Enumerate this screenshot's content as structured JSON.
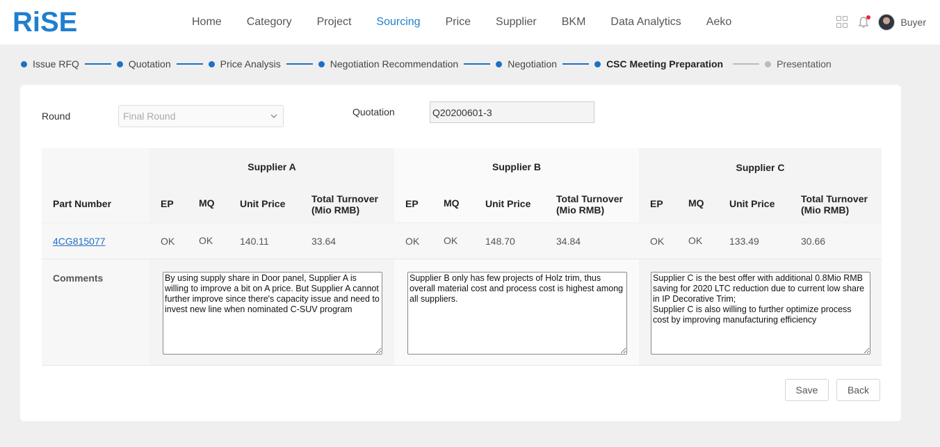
{
  "app": {
    "logo_text": "RiSE",
    "user_role": "Buyer"
  },
  "nav": {
    "items": [
      {
        "label": "Home"
      },
      {
        "label": "Category"
      },
      {
        "label": "Project"
      },
      {
        "label": "Sourcing",
        "active": true
      },
      {
        "label": "Price"
      },
      {
        "label": "Supplier"
      },
      {
        "label": "BKM"
      },
      {
        "label": "Data Analytics"
      },
      {
        "label": "Aeko"
      }
    ]
  },
  "icons": {
    "apps": "grid-icon",
    "notifications": "bell-icon",
    "dropdown": "chevron-down-icon"
  },
  "colors": {
    "accent": "#1f7fcf",
    "step_done": "#1f6fc4",
    "step_pending": "#bbbbbb",
    "notification_dot": "#ee2233"
  },
  "steps": [
    {
      "label": "Issue RFQ",
      "state": "done"
    },
    {
      "label": "Quotation",
      "state": "done"
    },
    {
      "label": "Price Analysis",
      "state": "done"
    },
    {
      "label": "Negotiation Recommendation",
      "state": "done"
    },
    {
      "label": "Negotiation",
      "state": "done"
    },
    {
      "label": "CSC Meeting Preparation",
      "state": "current"
    },
    {
      "label": "Presentation",
      "state": "pending"
    }
  ],
  "form": {
    "round_label": "Round",
    "round_value": "Final Round",
    "quotation_label": "Quotation",
    "quotation_value": "Q20200601-3"
  },
  "table": {
    "part_number_header": "Part Number",
    "comments_header": "Comments",
    "sub_headers": {
      "ep": "EP",
      "mq": "MQ",
      "unit_price": "Unit Price",
      "turnover_l1": "Total Turnover",
      "turnover_l2": "(Mio RMB)"
    },
    "part_number": "4CG815077",
    "suppliers": [
      {
        "name": "Supplier A",
        "ep": "OK",
        "mq": "OK",
        "unit_price": "140.11",
        "turnover": "33.64",
        "comment": "By using supply share in Door panel, Supplier A is willing to improve a bit on A price. But Supplier A cannot further improve since there's capacity issue and need to invest new line when nominated C-SUV program"
      },
      {
        "name": "Supplier B",
        "ep": "OK",
        "mq": "OK",
        "unit_price": "148.70",
        "turnover": "34.84",
        "comment": "Supplier B only has few projects of Holz trim, thus overall material cost and process cost is highest among all suppliers."
      },
      {
        "name": "Supplier C",
        "ep": "OK",
        "mq": "OK",
        "unit_price": "133.49",
        "turnover": "30.66",
        "comment": "Supplier C is the best offer with additional 0.8Mio RMB saving for 2020 LTC reduction due to current low share in IP Decorative Trim;\nSupplier C is also willing to further optimize process cost by improving manufacturing efficiency"
      }
    ]
  },
  "actions": {
    "save_label": "Save",
    "back_label": "Back"
  }
}
